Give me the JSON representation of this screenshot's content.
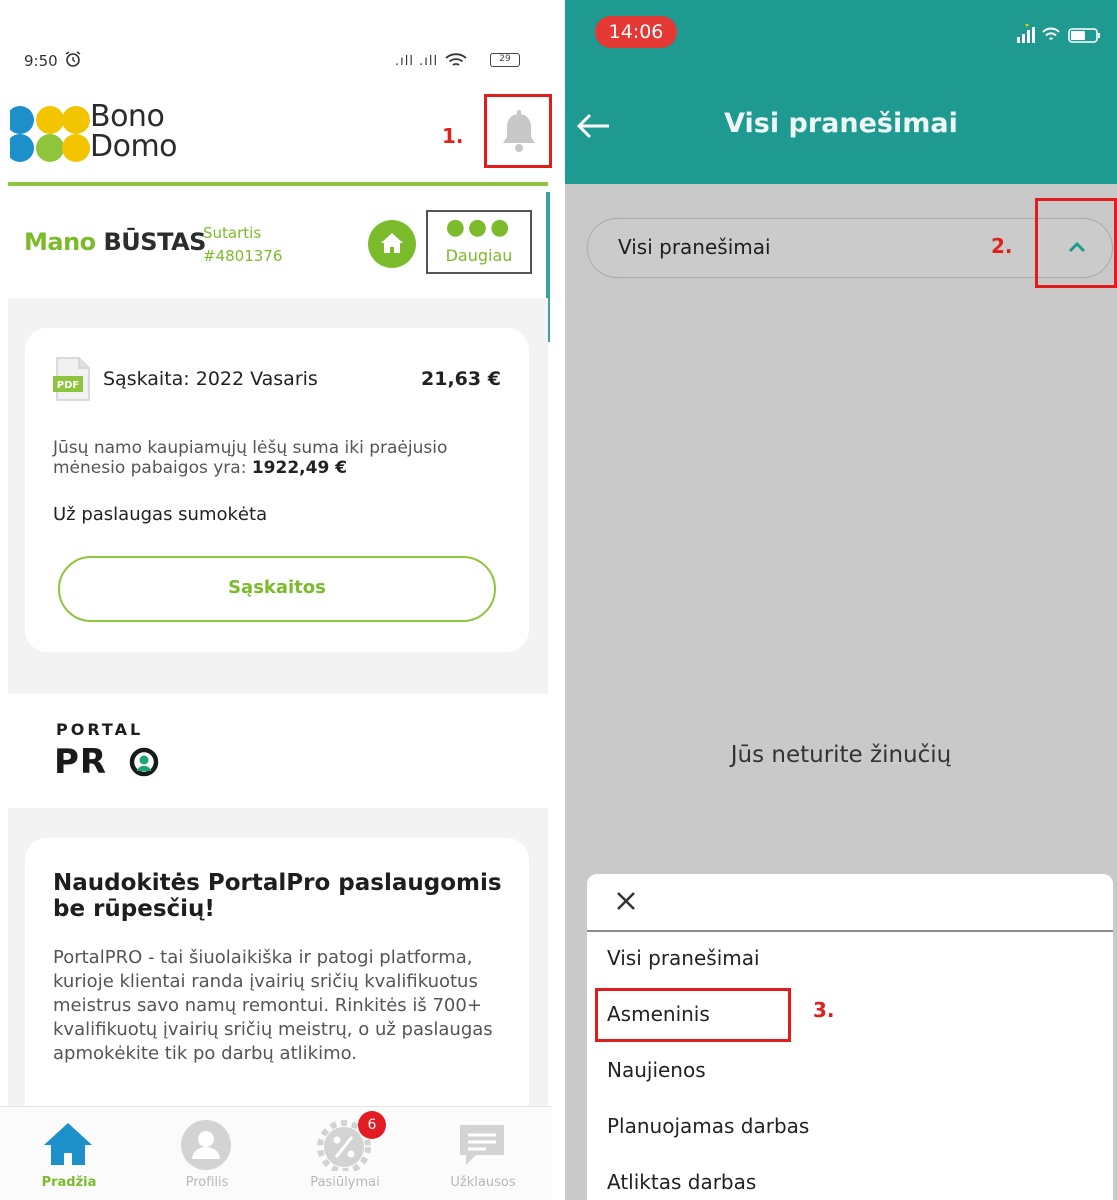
{
  "left": {
    "status": {
      "time": "9:50",
      "signal": ".ıll .ıll",
      "battery": "29"
    },
    "logo": {
      "line1": "Bono",
      "line2": "Domo"
    },
    "annotation_1": "1.",
    "section": {
      "title_part1": "Mano",
      "title_part2": "BŪSTAS",
      "contract_label": "Sutartis",
      "contract_number": "#4801376",
      "more_dots": "●●●",
      "more_label": "Daugiau"
    },
    "invoice": {
      "pdf_label": "PDF",
      "title": "Sąskaita: 2022 Vasaris",
      "amount": "21,63 €",
      "savings_text": "Jūsų namo kaupiamųjų lėšų suma iki praėjusio mėnesio pabaigos yra: ",
      "savings_amount": "1922,49 €",
      "paid_status": "Už paslaugas sumokėta",
      "button": "Sąskaitos"
    },
    "portal": {
      "small": "PORTAL",
      "big": "PR"
    },
    "promo": {
      "title": "Naudokitės PortalPro paslaugomis be rūpesčių!",
      "body": "PortalPRO - tai šiuolaikiška ir patogi platforma, kurioje klientai randa įvairių sričių kvalifikuotus meistrus savo namų remontui. Rinkitės iš 700+ kvalifikuotų įvairių sričių meistrų, o už paslaugas apmokėkite tik po darbų atlikimo."
    },
    "nav": {
      "home": "Pradžia",
      "profile": "Profilis",
      "offers": "Pasiūlymai",
      "offers_badge": "6",
      "requests": "Užklausos"
    },
    "colors": {
      "brand_green": "#7cbb2c",
      "annotation_red": "#e01c1c"
    }
  },
  "right": {
    "status": {
      "time": "14:06"
    },
    "header_title": "Visi pranešimai",
    "filter": {
      "selected": "Visi pranešimai"
    },
    "annotation_2": "2.",
    "annotation_3": "3.",
    "empty_message": "Jūs neturite žinučių",
    "options": [
      "Visi pranešimai",
      "Asmeninis",
      "Naujienos",
      "Planuojamas darbas",
      "Atliktas darbas"
    ],
    "colors": {
      "header_teal": "#1e9a91",
      "time_pill": "#e53935"
    }
  }
}
